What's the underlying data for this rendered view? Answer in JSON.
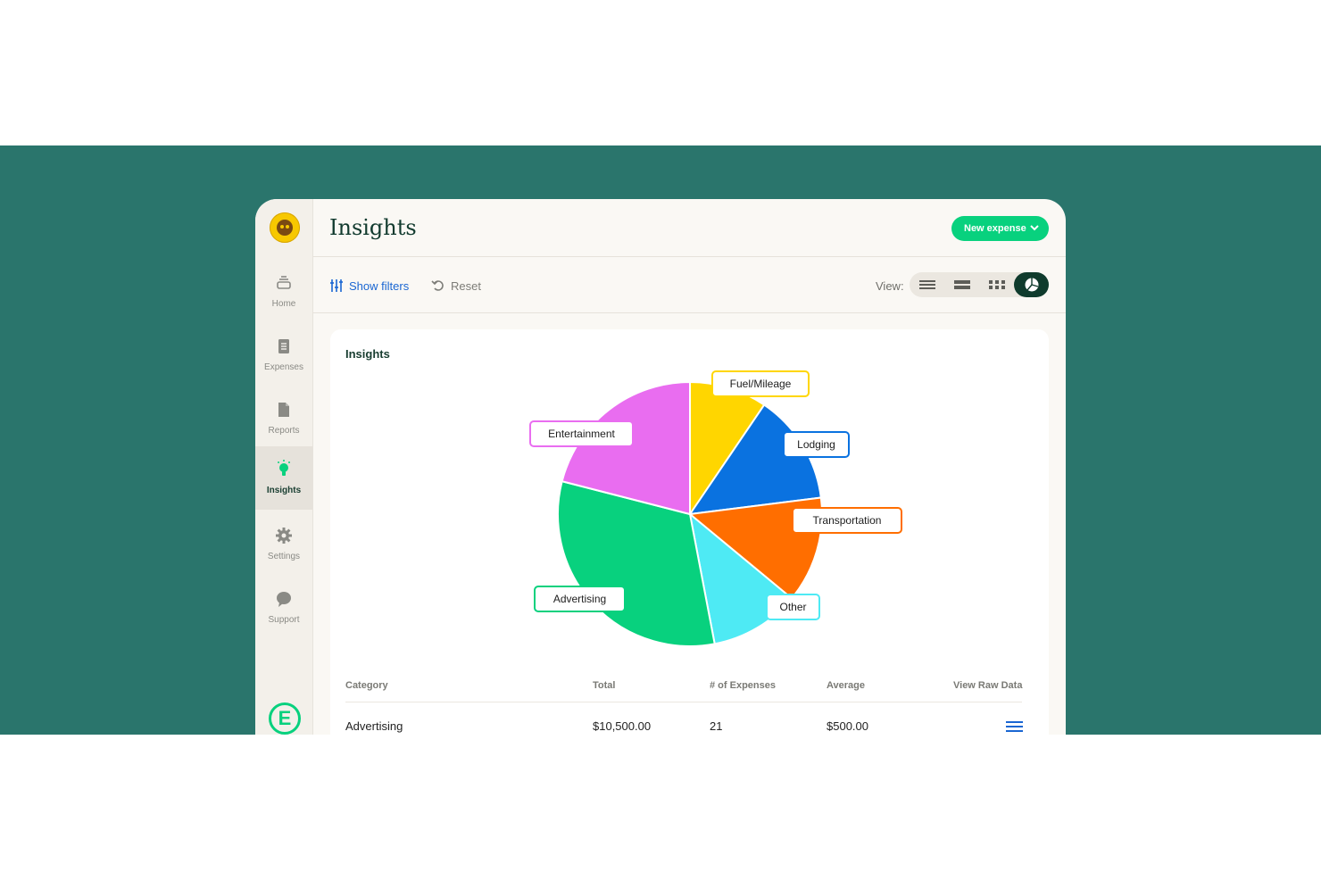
{
  "header": {
    "title": "Insights",
    "new_expense_label": "New expense"
  },
  "sidebar": {
    "items": [
      {
        "label": "Home",
        "icon": "home-icon"
      },
      {
        "label": "Expenses",
        "icon": "expenses-icon"
      },
      {
        "label": "Reports",
        "icon": "reports-icon"
      },
      {
        "label": "Insights",
        "icon": "lightbulb-icon",
        "active": true
      },
      {
        "label": "Settings",
        "icon": "gear-icon"
      },
      {
        "label": "Support",
        "icon": "chat-bubble-icon"
      }
    ],
    "logo_letter": "E"
  },
  "toolbar": {
    "show_filters_label": "Show filters",
    "reset_label": "Reset",
    "view_label": "View:",
    "view_options": [
      "list-icon",
      "compact-list-icon",
      "grid-icon",
      "pie-chart-icon"
    ],
    "active_view": "pie-chart-icon"
  },
  "card": {
    "title": "Insights"
  },
  "chart_data": {
    "type": "pie",
    "title": "",
    "slices": [
      {
        "label": "Fuel/Mileage",
        "percent": 9.5,
        "color": "#ffd600"
      },
      {
        "label": "Lodging",
        "percent": 13.5,
        "color": "#0a72e0"
      },
      {
        "label": "Transportation",
        "percent": 13.0,
        "color": "#ff6e00"
      },
      {
        "label": "Other",
        "percent": 11.0,
        "color": "#4eeaf4"
      },
      {
        "label": "Advertising",
        "percent": 32.0,
        "color": "#08d17e"
      },
      {
        "label": "Entertainment",
        "percent": 21.0,
        "color": "#e96df0"
      }
    ]
  },
  "table": {
    "headers": [
      "Category",
      "Total",
      "# of Expenses",
      "Average",
      "View Raw Data"
    ],
    "rows": [
      {
        "category": "Advertising",
        "total": "$10,500.00",
        "count": "21",
        "average": "$500.00"
      }
    ]
  },
  "colors": {
    "background_band": "#2a756c",
    "accent_green": "#08d17e",
    "dark_green": "#0f3b2d",
    "link_blue": "#1a66d2"
  }
}
